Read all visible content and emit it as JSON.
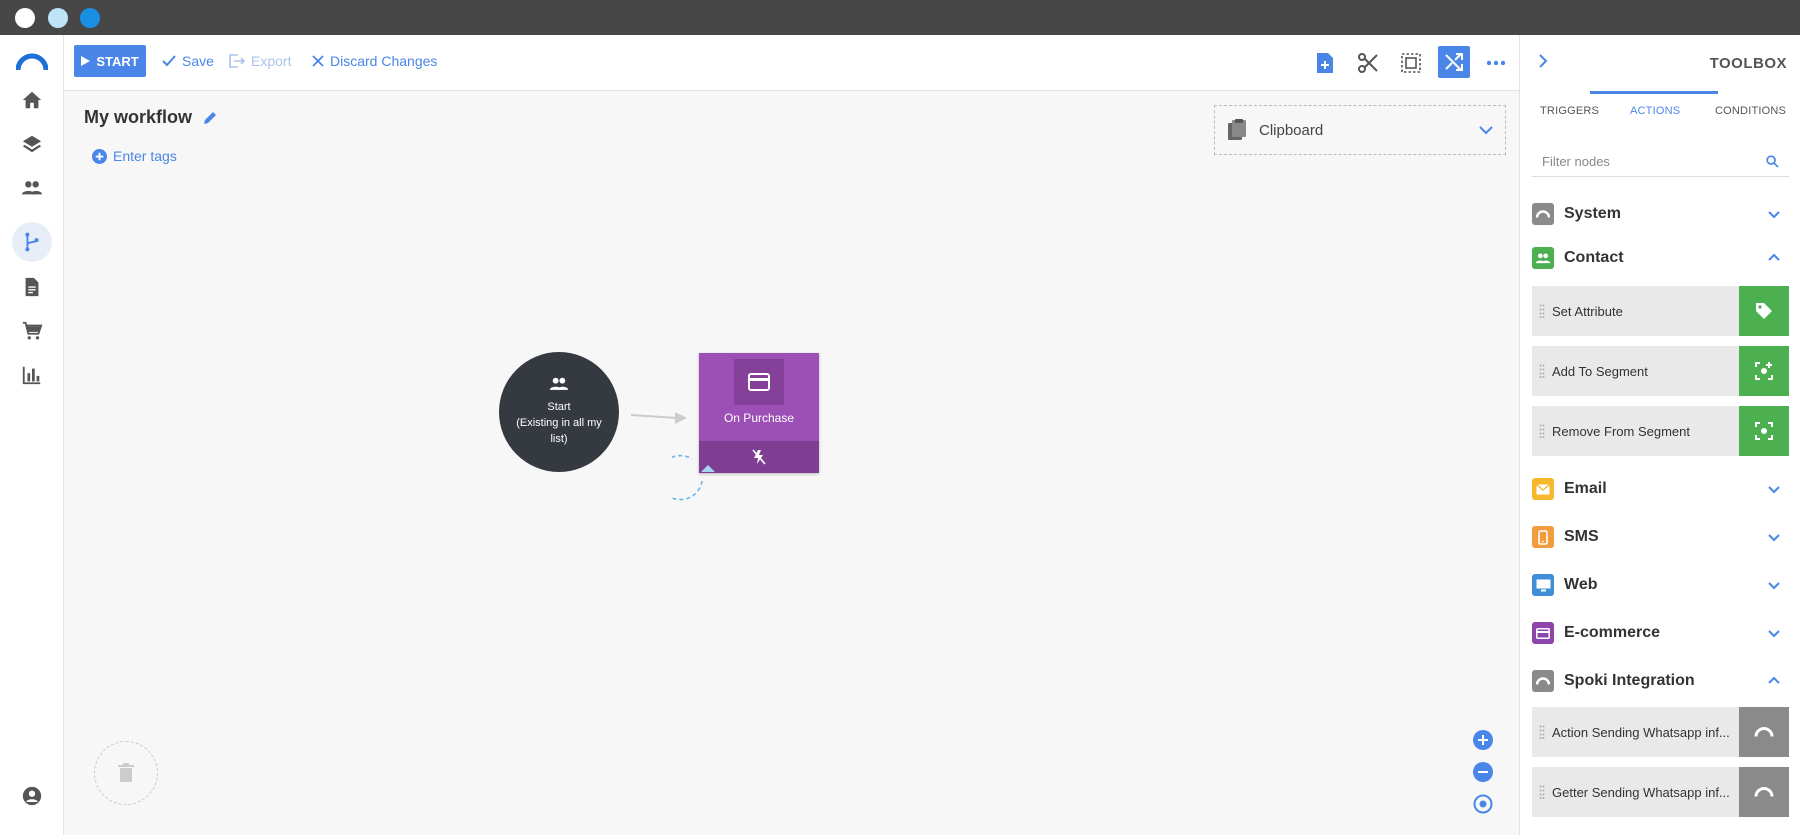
{
  "toolbar": {
    "start_label": "START",
    "save_label": "Save",
    "export_label": "Export",
    "discard_label": "Discard Changes"
  },
  "workflow": {
    "title": "My workflow",
    "tags_label": "Enter tags"
  },
  "clipboard": {
    "label": "Clipboard"
  },
  "nodes": {
    "start": {
      "title": "Start",
      "subtitle": "(Existing in all my list)"
    },
    "purchase": {
      "label": "On Purchase",
      "color": "#9c4fb5"
    }
  },
  "toolbox": {
    "title": "TOOLBOX",
    "tabs": [
      "TRIGGERS",
      "ACTIONS",
      "CONDITIONS"
    ],
    "active_tab": "ACTIONS",
    "filter_placeholder": "Filter nodes",
    "categories": [
      {
        "label": "System",
        "color": "#8a8a8a",
        "icon": "arc-icon",
        "expanded": false
      },
      {
        "label": "Contact",
        "color": "#4caf50",
        "icon": "people-icon",
        "expanded": true
      },
      {
        "label": "Email",
        "color": "#f5b82e",
        "icon": "envelope-icon",
        "expanded": false
      },
      {
        "label": "SMS",
        "color": "#f39c3d",
        "icon": "phone-icon",
        "expanded": false
      },
      {
        "label": "Web",
        "color": "#3f8fd8",
        "icon": "monitor-icon",
        "expanded": false
      },
      {
        "label": "E-commerce",
        "color": "#8e44ad",
        "icon": "card-icon",
        "expanded": false
      },
      {
        "label": "Spoki Integration",
        "color": "#8a8a8a",
        "icon": "arc-icon",
        "expanded": true
      }
    ],
    "contact_items": [
      {
        "label": "Set Attribute",
        "icon": "tag-icon"
      },
      {
        "label": "Add To Segment",
        "icon": "segment-add-icon"
      },
      {
        "label": "Remove From Segment",
        "icon": "segment-remove-icon"
      }
    ],
    "spoki_items": [
      {
        "label": "Action Sending Whatsapp inf...",
        "icon": "arc-icon"
      },
      {
        "label": "Getter Sending Whatsapp inf...",
        "icon": "arc-icon"
      }
    ]
  },
  "colors": {
    "accent": "#4a86e8",
    "contact_green": "#4caf50",
    "start_node": "#343a40"
  }
}
